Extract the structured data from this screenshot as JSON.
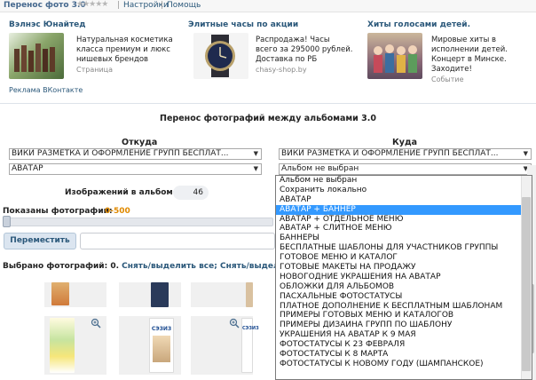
{
  "topbar": {
    "app_title": "Перенос фото 3.0",
    "stars": "★★★★★",
    "links": [
      "Настройки",
      "Помощь"
    ],
    "separator": "|"
  },
  "ads": [
    {
      "title": "Вэлнэс Юнайтед",
      "text": "Натуральная косметика класса премиум и люкс нишевых брендов",
      "source": "Страница",
      "color": "#6b8a4a"
    },
    {
      "title": "Элитные часы по акции",
      "text": "Распродажа! Часы всего за 295000 рублей. Доставка по РБ",
      "source": "chasy-shop.by",
      "color": "#3a3a48"
    },
    {
      "title": "Хиты голосами детей.",
      "text": "Мировые хиты в исполнении детей. Концерт в Минске. Заходите!",
      "source": "Событие",
      "color": "#7a6a8a"
    }
  ],
  "ads_footer": "Реклама ВКонтакте",
  "main": {
    "title": "Перенос фотографий между альбомами 3.0",
    "from_label": "Откуда",
    "to_label": "Куда",
    "from_group": "ВИКИ РАЗМЕТКА И ОФОРМЛЕНИЕ ГРУПП БЕСПЛАТ...",
    "from_album": "АВАТАР",
    "to_group": "ВИКИ РАЗМЕТКА И ОФОРМЛЕНИЕ ГРУПП БЕСПЛАТ...",
    "to_album": "Альбом не выбран",
    "count_label": "Изображений в альбоме:",
    "count_value": "46",
    "shown_label": "Показаны фотографии:",
    "shown_range": "0-500",
    "move_button": "Переместить",
    "selected_label": "Выбрано фотографий: 0.",
    "select_all_link": "Снять/выделить все;",
    "select_link2": "Снять/выделить п"
  },
  "dropdown": {
    "items": [
      "Альбом не выбран",
      "Сохранить локально",
      "АВАТАР",
      "АВАТАР + БАННЕР",
      "АВАТАР + ОТДЕЛЬНОЕ МЕНЮ",
      "АВАТАР + СЛИТНОЕ МЕНЮ",
      "БАННЕРЫ",
      "БЕСПЛАТНЫЕ ШАБЛОНЫ ДЛЯ УЧАСТНИКОВ ГРУППЫ",
      "ГОТОВОЕ МЕНЮ И КАТАЛОГ",
      "ГОТОВЫЕ МАКЕТЫ НА ПРОДАЖУ",
      "НОВОГОДНИЕ УКРАШЕНИЯ НА АВАТАР",
      "ОБЛОЖКИ ДЛЯ АЛЬБОМОВ",
      "ПАСХАЛЬНЫЕ ФОТОСТАТУСЫ",
      "ПЛАТНОЕ ДОПОЛНЕНИЕ К БЕСПЛАТНЫМ ШАБЛОНАМ",
      "ПРИМЕРЫ ГОТОВЫХ МЕНЮ И КАТАЛОГОВ",
      "ПРИМЕРЫ ДИЗАЙНА ГРУПП ПО ШАБЛОНУ",
      "УКРАШЕНИЯ НА АВАТАР К 9 МАЯ",
      "ФОТОСТАТУСЫ К 23 ФЕВРАЛЯ",
      "ФОТОСТАТУСЫ К 8 МАРТА",
      "ФОТОСТАТУСЫ К НОВОМУ ГОДУ (ШАМПАНСКОЕ)"
    ],
    "highlighted_index": 3
  },
  "thumbs": {
    "sezis_label": "СЭЗИЗ"
  },
  "colors": {
    "accent": "#2b587a",
    "highlight": "#3399ff",
    "range": "#e08a00"
  }
}
